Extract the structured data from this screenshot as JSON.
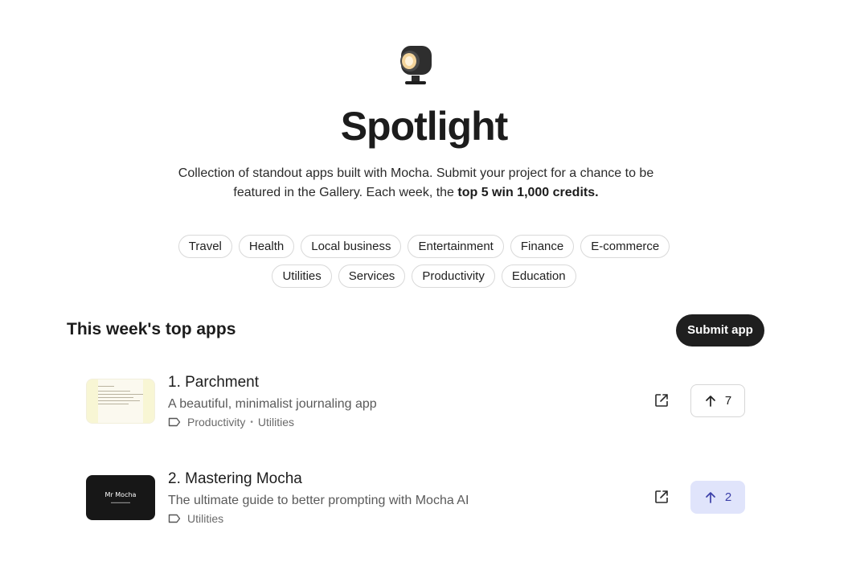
{
  "hero": {
    "title": "Spotlight",
    "subtitle_text": "Collection of standout apps built with Mocha. Submit your project for a chance to be featured in the Gallery. Each week, the ",
    "subtitle_bold": "top 5 win 1,000 credits."
  },
  "categories_row1": [
    "Travel",
    "Health",
    "Local business",
    "Entertainment",
    "Finance",
    "E-commerce"
  ],
  "categories_row2": [
    "Utilities",
    "Services",
    "Productivity",
    "Education"
  ],
  "section": {
    "title": "This week's top apps",
    "submit_label": "Submit app"
  },
  "apps": [
    {
      "name": "1. Parchment",
      "description": "A beautiful, minimalist journaling app",
      "tags": [
        "Productivity",
        "Utilities"
      ],
      "votes": "7",
      "voted": false
    },
    {
      "name": "2. Mastering Mocha",
      "description": "The ultimate guide to better prompting with Mocha AI",
      "tags": [
        "Utilities"
      ],
      "votes": "2",
      "voted": true,
      "thumb_text": "Mr Mocha"
    }
  ],
  "icons": {
    "hero": "spotlight-lamp-icon",
    "tag": "tag-icon",
    "external": "external-link-icon",
    "upvote": "arrow-up-icon"
  },
  "colors": {
    "primary_button": "#1f1f1f",
    "voted_bg": "#e0e4fb",
    "voted_text": "#3b3fa8"
  }
}
